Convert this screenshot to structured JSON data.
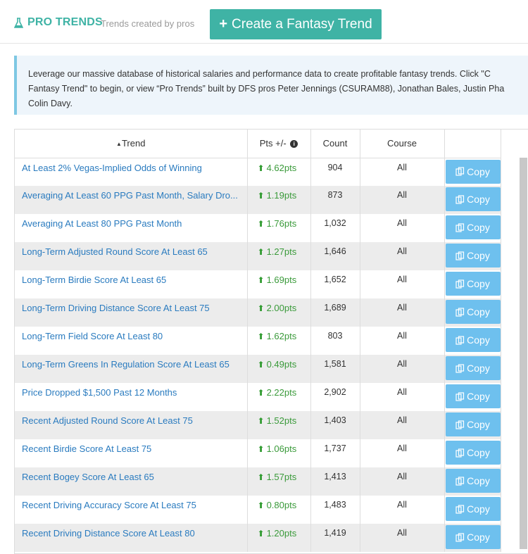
{
  "header": {
    "title": "PRO TRENDS",
    "subtitle": "Trends created by pros",
    "create_button": "Create a Fantasy Trend",
    "accent": "#3fb3a5"
  },
  "info": {
    "line1": "Leverage our massive database of historical salaries and performance data to create profitable fantasy trends. Click \"C",
    "line2": "Fantasy Trend\" to begin, or view “Pro Trends” built by DFS pros Peter Jennings (CSURAM88), Jonathan Bales, Justin Pha",
    "line3": "Colin Davy."
  },
  "table": {
    "columns": {
      "trend": "Trend",
      "pts": "Pts +/-",
      "count": "Count",
      "course": "Course"
    },
    "sort_indicator": "▲",
    "copy_label": "Copy",
    "rows": [
      {
        "trend": "At Least 2% Vegas-Implied Odds of Winning",
        "pts": "4.62pts",
        "count": "904",
        "course": "All"
      },
      {
        "trend": "Averaging At Least 60 PPG Past Month, Salary Dro...",
        "pts": "1.19pts",
        "count": "873",
        "course": "All"
      },
      {
        "trend": "Averaging At Least 80 PPG Past Month",
        "pts": "1.76pts",
        "count": "1,032",
        "course": "All"
      },
      {
        "trend": "Long-Term Adjusted Round Score At Least 65",
        "pts": "1.27pts",
        "count": "1,646",
        "course": "All"
      },
      {
        "trend": "Long-Term Birdie Score At Least 65",
        "pts": "1.69pts",
        "count": "1,652",
        "course": "All"
      },
      {
        "trend": "Long-Term Driving Distance Score At Least 75",
        "pts": "2.00pts",
        "count": "1,689",
        "course": "All"
      },
      {
        "trend": "Long-Term Field Score At Least 80",
        "pts": "1.62pts",
        "count": "803",
        "course": "All"
      },
      {
        "trend": "Long-Term Greens In Regulation Score At Least 65",
        "pts": "0.49pts",
        "count": "1,581",
        "course": "All"
      },
      {
        "trend": "Price Dropped $1,500 Past 12 Months",
        "pts": "2.22pts",
        "count": "2,902",
        "course": "All"
      },
      {
        "trend": "Recent Adjusted Round Score At Least 75",
        "pts": "1.52pts",
        "count": "1,403",
        "course": "All"
      },
      {
        "trend": "Recent Birdie Score At Least 75",
        "pts": "1.06pts",
        "count": "1,737",
        "course": "All"
      },
      {
        "trend": "Recent Bogey Score At Least 65",
        "pts": "1.57pts",
        "count": "1,413",
        "course": "All"
      },
      {
        "trend": "Recent Driving Accuracy Score At Least 75",
        "pts": "0.80pts",
        "count": "1,483",
        "course": "All"
      },
      {
        "trend": "Recent Driving Distance Score At Least 80",
        "pts": "1.20pts",
        "count": "1,419",
        "course": "All"
      }
    ]
  }
}
